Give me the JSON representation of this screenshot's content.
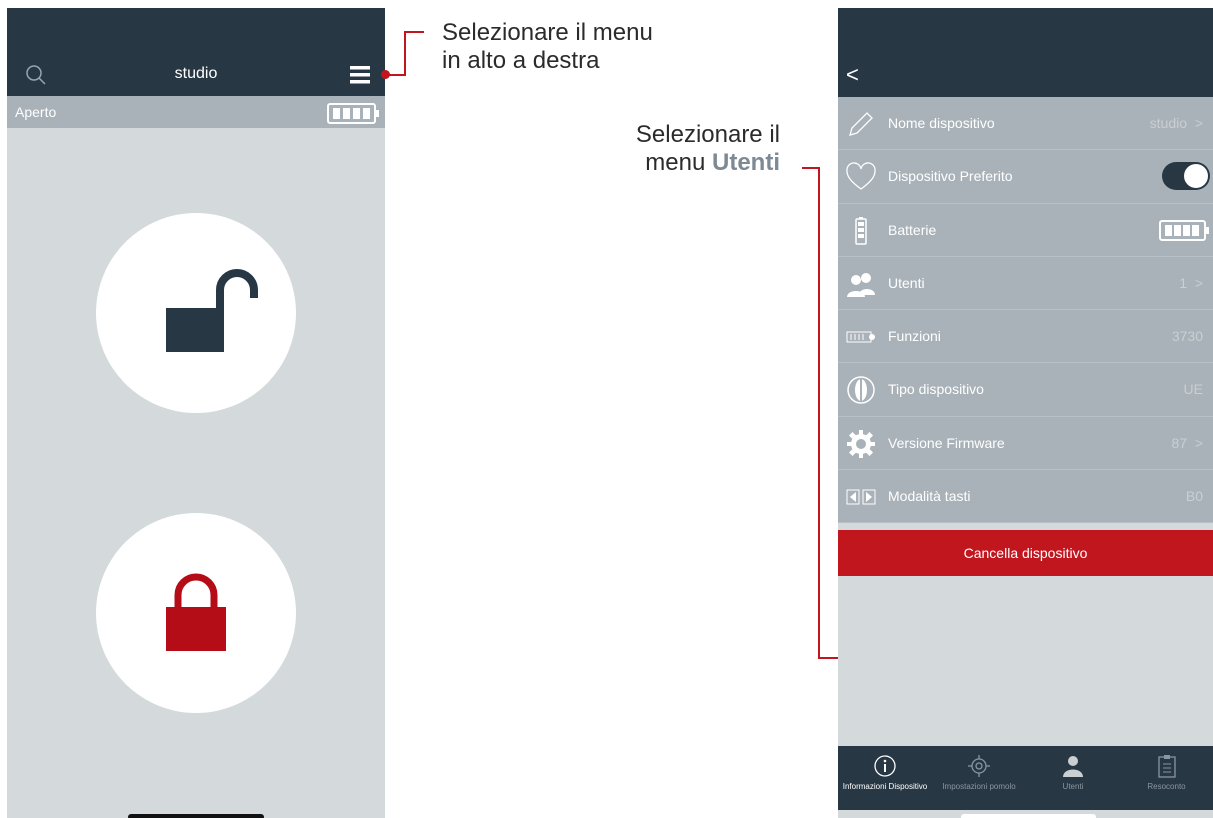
{
  "left": {
    "title": "studio",
    "status": "Aperto",
    "icons": [
      "search-icon",
      "hamburger-menu-icon",
      "battery-icon",
      "unlock-icon",
      "lock-icon"
    ]
  },
  "annotations": {
    "top_line1": "Selezionare il menu",
    "top_line2": "in alto a destra",
    "users_line1": "Selezionare il",
    "users_line2_prefix": "menu ",
    "users_line2_bold": "Utenti"
  },
  "right": {
    "back": "<",
    "rows": [
      {
        "label": "Nome dispositivo",
        "value": "studio",
        "chevron": true,
        "icon": "pencil-icon"
      },
      {
        "label": "Dispositivo Preferito",
        "value": "",
        "toggle": true,
        "icon": "heart-icon"
      },
      {
        "label": "Batterie",
        "value": "",
        "icon": "battery-icon"
      },
      {
        "label": "Utenti",
        "value": "1",
        "chevron": true,
        "icon": "users-icon"
      },
      {
        "label": "Funzioni",
        "value": "3730",
        "icon": "functions-icon"
      },
      {
        "label": "Tipo dispositivo",
        "value": "UE",
        "icon": "knob-icon"
      },
      {
        "label": "Versione Firmware",
        "value": "87",
        "chevron": true,
        "icon": "gear-icon"
      },
      {
        "label": "Modalità tasti",
        "value": "B0",
        "icon": "arrows-icon"
      }
    ],
    "delete_button": "Cancella dispositivo",
    "tabs": [
      {
        "label": "Informazioni Dispositivo",
        "icon": "info-icon"
      },
      {
        "label": "Impostazioni pomolo",
        "icon": "settings-icon"
      },
      {
        "label": "Utenti",
        "icon": "user-icon"
      },
      {
        "label": "Resoconto",
        "icon": "report-icon"
      }
    ]
  },
  "colors": {
    "header": "#283744",
    "accent_red": "#c2161f",
    "background": "#d4d9dc",
    "row": "#a9b2b8"
  }
}
